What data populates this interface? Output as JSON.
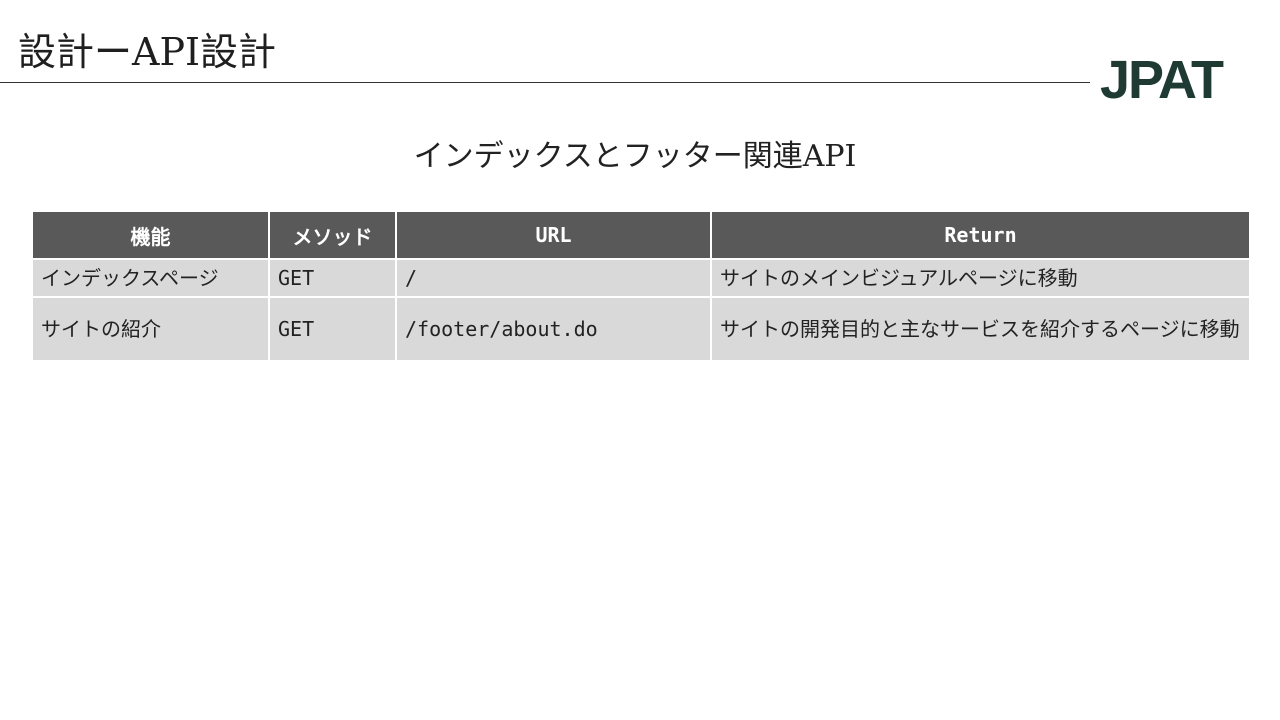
{
  "slide": {
    "title": "設計ーAPI設計",
    "logo": {
      "text": "JPAT",
      "color": "#1f3a33"
    },
    "heading": "インデックスとフッター関連API"
  },
  "table": {
    "header_bg": "#595959",
    "row_bg": "#d9d9d9",
    "columns": [
      "機能",
      "メソッド",
      "URL",
      "Return"
    ],
    "rows": [
      {
        "function": "インデックスページ",
        "method": "GET",
        "url": "/",
        "return": "サイトのメインビジュアルページに移動"
      },
      {
        "function": "サイトの紹介",
        "method": "GET",
        "url": "/footer/about.do",
        "return": "サイトの開発目的と主なサービスを紹介するページに移動"
      }
    ]
  }
}
